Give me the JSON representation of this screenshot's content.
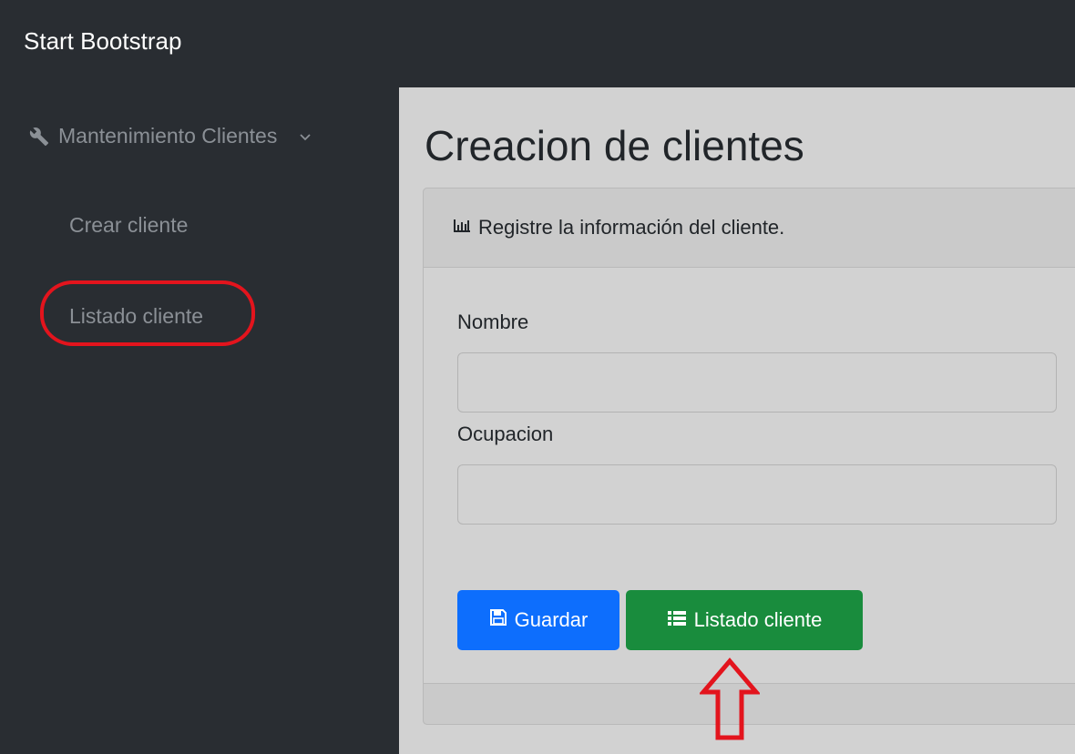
{
  "app": {
    "brand": "Start Bootstrap"
  },
  "sidebar": {
    "section": {
      "label": "Mantenimiento Clientes",
      "icon": "wrench-icon",
      "expanded": true
    },
    "items": [
      {
        "label": "Crear cliente"
      },
      {
        "label": "Listado cliente",
        "highlighted": true
      }
    ]
  },
  "page": {
    "title": "Creacion de clientes"
  },
  "card": {
    "header": {
      "icon": "bar-chart-icon",
      "text": "Registre la información del cliente."
    },
    "fields": [
      {
        "label": "Nombre",
        "value": "",
        "placeholder": ""
      },
      {
        "label": "Ocupacion",
        "value": "",
        "placeholder": ""
      }
    ],
    "buttons": [
      {
        "label": "Guardar",
        "icon": "save-icon",
        "color": "#0d6efd"
      },
      {
        "label": "Listado cliente",
        "icon": "list-icon",
        "color": "#198c3d"
      }
    ]
  },
  "annotations": {
    "highlight_color": "#e3141d"
  },
  "colors": {
    "topbar": "#292d32",
    "sidebar": "#292d32",
    "main_bg": "#d2d2d2"
  }
}
